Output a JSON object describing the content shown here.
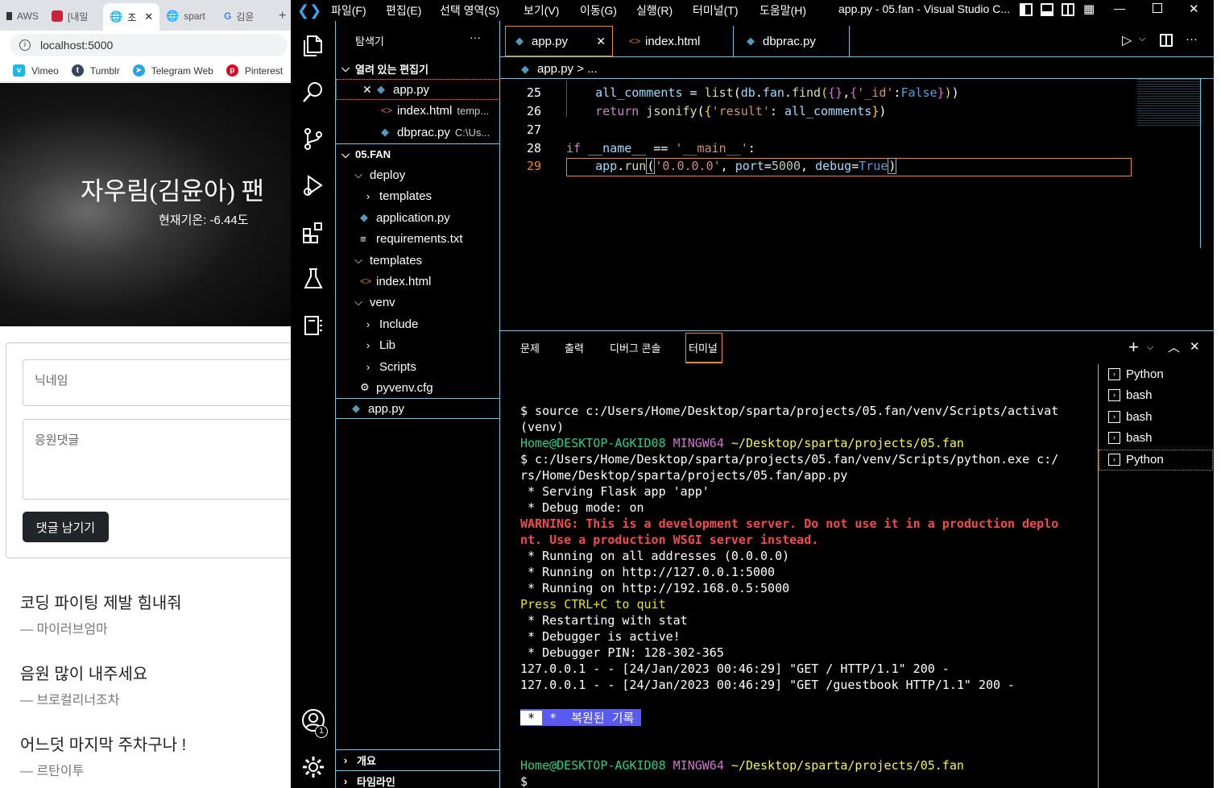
{
  "browser": {
    "tabs": [
      "AWS",
      "[내일",
      "조",
      "spart",
      "김윤"
    ],
    "address": "localhost:5000",
    "bookmarks": [
      "Vimeo",
      "Tumblr",
      "Telegram Web",
      "Pinterest"
    ],
    "hero_title": "자우림(김윤아) 팬",
    "hero_subtitle": "현재기온: -6.44도",
    "nickname_placeholder": "닉네임",
    "comment_placeholder": "응원댓글",
    "submit_label": "댓글 남기기",
    "comments": [
      {
        "text": "코딩 파이팅 제발 힘내줘",
        "author": "— 마이러브엄마"
      },
      {
        "text": "음원 많이 내주세요",
        "author": "— 브로컬리너조차"
      },
      {
        "text": "어느덧 마지막 주차구나 !",
        "author": "— 르탄이투"
      }
    ]
  },
  "vscode": {
    "menu": [
      "파일(F)",
      "편집(E)",
      "선택 영역(S)",
      "보기(V)",
      "이동(G)",
      "실행(R)",
      "터미널(T)",
      "도움말(H)"
    ],
    "window_title": "app.py - 05.fan - Visual Studio C...",
    "explorer_title": "탐색기",
    "open_editors_label": "열려 있는 편집기",
    "open_editors": [
      {
        "name": "app.py",
        "detail": ""
      },
      {
        "name": "index.html",
        "detail": "temp..."
      },
      {
        "name": "dbprac.py",
        "detail": "C:\\Us..."
      }
    ],
    "project_label": "05.FAN",
    "tree": [
      "deploy",
      "templates",
      "application.py",
      "requirements.txt",
      "templates",
      "index.html",
      "venv",
      "Include",
      "Lib",
      "Scripts",
      "pyvenv.cfg",
      "app.py"
    ],
    "outline_label": "개요",
    "timeline_label": "타임라인",
    "editor_tabs": [
      "app.py",
      "index.html",
      "dbprac.py"
    ],
    "breadcrumb": "app.py > ...",
    "line_numbers": [
      "25",
      "26",
      "27",
      "28",
      "29"
    ],
    "panel_tabs": [
      "문제",
      "출력",
      "디버그 콘솔",
      "터미널"
    ],
    "terminal_lines": [
      "$ source c:/Users/Home/Desktop/sparta/projects/05.fan/venv/Scripts/activat",
      "(venv)",
      "$ c:/Users/Home/Desktop/sparta/projects/05.fan/venv/Scripts/python.exe c:/",
      "rs/Home/Desktop/sparta/projects/05.fan/app.py",
      " * Serving Flask app 'app'",
      " * Debug mode: on",
      " * Running on all addresses (0.0.0.0)",
      " * Running on http://127.0.0.1:5000",
      " * Running on http://192.168.0.5:5000",
      "Press CTRL+C to quit",
      " * Restarting with stat",
      " * Debugger is active!",
      " * Debugger PIN: 128-302-365",
      "127.0.0.1 - - [24/Jan/2023 00:46:29] \"GET / HTTP/1.1\" 200 -",
      "127.0.0.1 - - [24/Jan/2023 00:46:29] \"GET /guestbook HTTP/1.1\" 200 -",
      "$"
    ],
    "prompt_user": "Home@DESKTOP-AGKID08",
    "prompt_env": "MINGW64",
    "prompt_path": "~/Desktop/sparta/projects/05.fan",
    "warning_1": "WARNING: This is a development server. Do not use it in a production deplo",
    "warning_2": "nt. Use a production WSGI server instead.",
    "restored_label": " *  복원된 기록 ",
    "terminal_list": [
      "Python",
      "bash",
      "bash",
      "bash",
      "Python"
    ],
    "accounts_badge": "1"
  }
}
